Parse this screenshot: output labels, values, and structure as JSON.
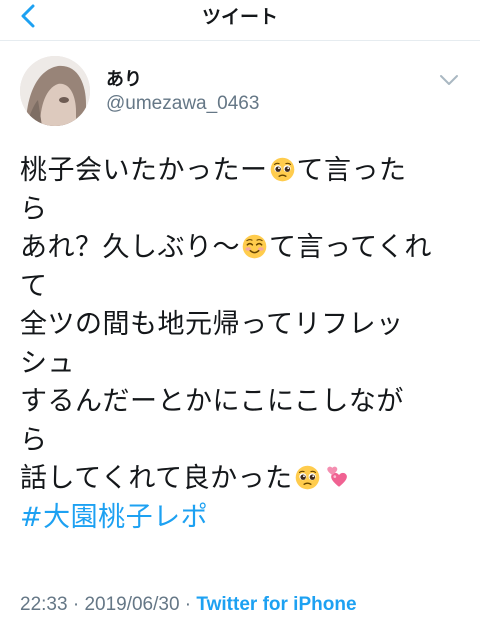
{
  "navbar": {
    "title": "ツイート"
  },
  "tweet": {
    "display_name": "あり",
    "handle": "@umezawa_0463",
    "lines": [
      {
        "before": "桃子会いたかったー",
        "emoji": "pleading-face",
        "after": "て言った"
      },
      {
        "before": "ら",
        "emoji": null,
        "after": ""
      },
      {
        "before": "あれ？久しぶり〜",
        "emoji": "smiling-face",
        "after": "て言ってくれ"
      },
      {
        "before": "て",
        "emoji": null,
        "after": ""
      },
      {
        "before": "全ツの間も地元帰ってリフレッ",
        "emoji": null,
        "after": ""
      },
      {
        "before": "シュ",
        "emoji": null,
        "after": ""
      },
      {
        "before": "するんだーとかにこにこしなが",
        "emoji": null,
        "after": ""
      },
      {
        "before": "ら",
        "emoji": null,
        "after": ""
      },
      {
        "before": "話してくれて良かった",
        "emoji": "pleading-face",
        "after": ""
      }
    ],
    "hashtag": "#大園桃子レポ",
    "time": "22:33",
    "separator1": " · ",
    "date": "2019/06/30",
    "separator2": " · ",
    "source": "Twitter for iPhone"
  },
  "colors": {
    "accent": "#1da1f2",
    "secondary_text": "#657786",
    "primary_text": "#14171a"
  }
}
